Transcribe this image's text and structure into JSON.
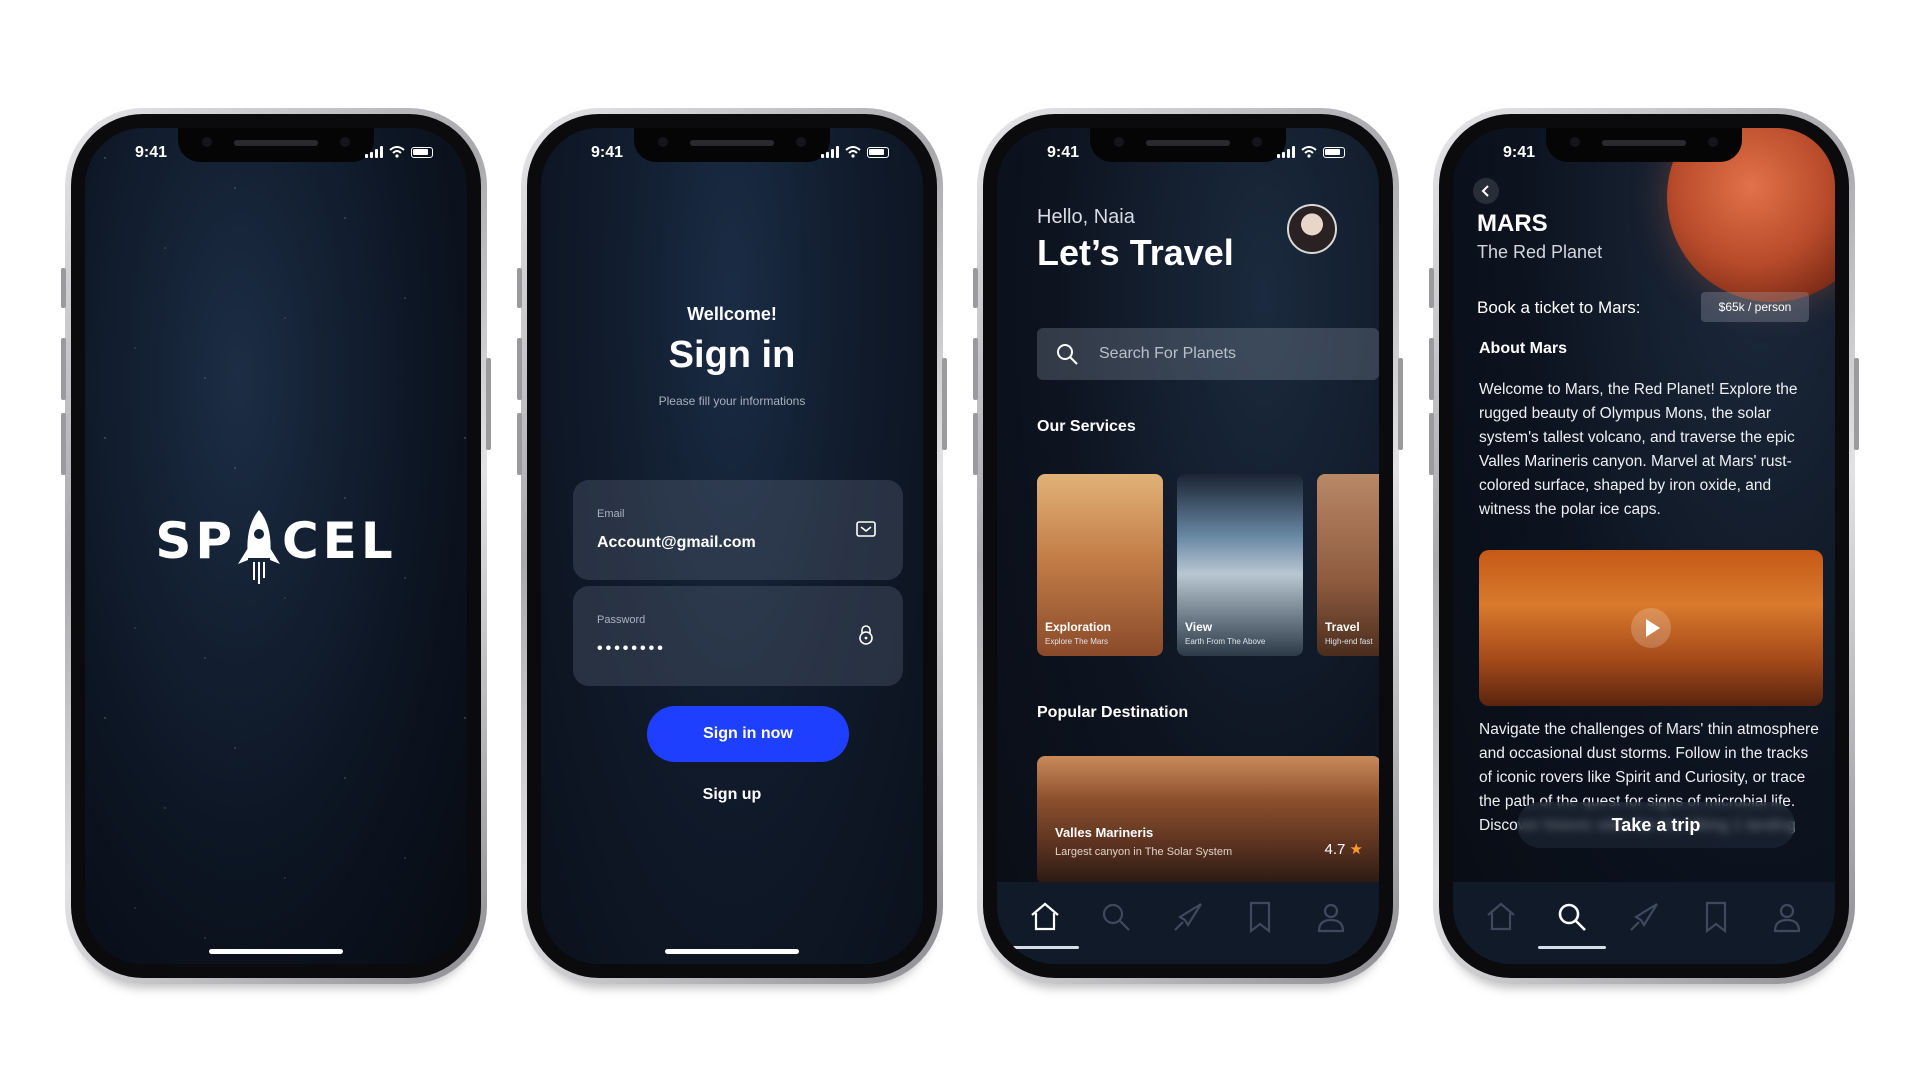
{
  "status": {
    "time": "9:41"
  },
  "splash": {
    "logo_left": "SP",
    "logo_right": "CEL"
  },
  "signin": {
    "greeting": "Wellcome!",
    "title": "Sign in",
    "subtitle": "Please fill your informations",
    "email_label": "Email",
    "email_value": "Account@gmail.com",
    "password_label": "Password",
    "password_value": "••••••••",
    "primary_button": "Sign in now",
    "secondary_link": "Sign up"
  },
  "home": {
    "greeting": "Hello, Naia",
    "title": "Let’s Travel",
    "search_placeholder": "Search For Planets",
    "services_title": "Our Services",
    "services": [
      {
        "title": "Exploration",
        "desc": "Explore The Mars"
      },
      {
        "title": "View",
        "desc": "Earth From The Above"
      },
      {
        "title": "Travel",
        "desc": "High-end fast"
      }
    ],
    "popular_title": "Popular Destination",
    "destination": {
      "name": "Valles Marineris",
      "desc": "Largest canyon in The Solar System",
      "rating": "4.7",
      "star": "★"
    }
  },
  "detail": {
    "name": "MARS",
    "tagline": "The Red Planet",
    "book_label": "Book a ticket to Mars:",
    "price": "$65k / person",
    "about_title": "About Mars",
    "about_text": "Welcome to Mars, the Red Planet! Explore the rugged beauty of Olympus Mons, the solar system's tallest volcano, and traverse the epic Valles Marineris canyon. Marvel at Mars' rust-colored surface, shaped by iron oxide, and witness the polar ice caps.",
    "more_text": "Navigate the challenges of Mars' thin atmosphere and occasional dust storms. Follow in the tracks of iconic rovers like Spirit and Curiosity, or trace the path of the quest for signs of microbial life. Discover historic sites like the Viking 1 landing",
    "cta": "Take a trip"
  },
  "icons": [
    "home-icon",
    "search-icon",
    "rocket-icon",
    "bookmark-icon",
    "profile-icon",
    "mail-icon",
    "lock-icon",
    "back-icon",
    "play-icon"
  ],
  "colors": {
    "primary": "#1f3fff",
    "star": "#ff9a2e",
    "tabbar": "#111a28"
  }
}
